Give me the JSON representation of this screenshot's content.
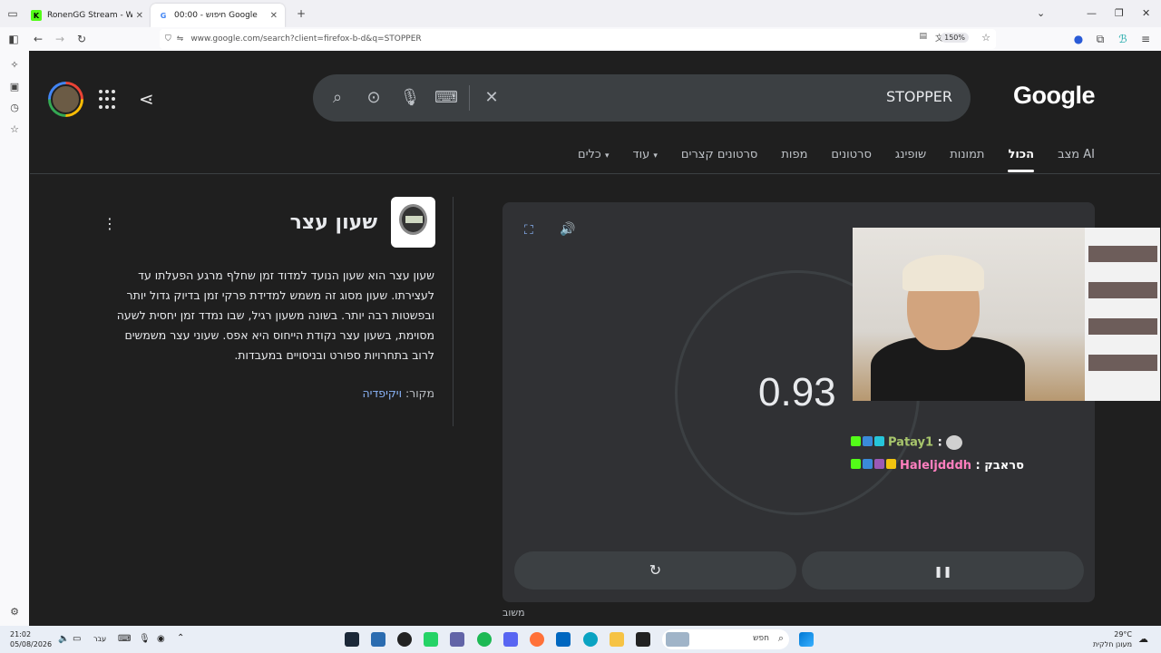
{
  "browser": {
    "tabs": [
      {
        "title": "RonenGG Stream - Watch L",
        "active": false
      },
      {
        "title": "00:00 - חיפוש Google",
        "active": true
      }
    ],
    "url": "www.google.com/search?client=firefox-b-d&q=STOPPER",
    "zoom": "150%"
  },
  "search": {
    "query": "STOPPER",
    "logo": "Google"
  },
  "tabs": [
    "מצב AI",
    "הכול",
    "תמונות",
    "שופינג",
    "סרטונים",
    "מפות",
    "סרטונים קצרים",
    "עוד",
    "כלים"
  ],
  "selected_tab": "הכול",
  "knowledge_panel": {
    "title": "שעון עצר",
    "description": "שעון עצר הוא שעון הנועד למדוד זמן שחלף מרגע הפעלתו עד לעצירתו. שעון מסוג זה משמש למדידת פרקי זמן בדיוק גדול יותר ובפשטות רבה יותר. בשונה משעון רגיל, שבו נמדד זמן יחסית לשעה מסוימת, בשעון עצר נקודת הייחוס היא אפס. שעוני עצר משמשים לרוב בתחרויות ספורט ובניסויים במעבדות.",
    "source_label": "מקור:",
    "source_link": "ויקיפדיה"
  },
  "stopwatch": {
    "time": "0.93",
    "reset_icon": "↻",
    "pause_icon": "❚❚",
    "feedback": "משוב"
  },
  "chat": [
    {
      "user": "Patay1",
      "message": ":",
      "color": "#a8c66c"
    },
    {
      "user": "Haleljdddh",
      "message": ": סראבק",
      "color": "#ff7fbf"
    }
  ],
  "taskbar": {
    "time": "21:02",
    "date": "05/08/2026",
    "lang": "עבר",
    "search_placeholder": "חפש",
    "weather_temp": "29°C",
    "weather_desc": "מעונן חלקית"
  },
  "colors": {
    "page_bg": "#1f1f1f",
    "card_bg": "#303134",
    "link": "#8ab4f8"
  }
}
